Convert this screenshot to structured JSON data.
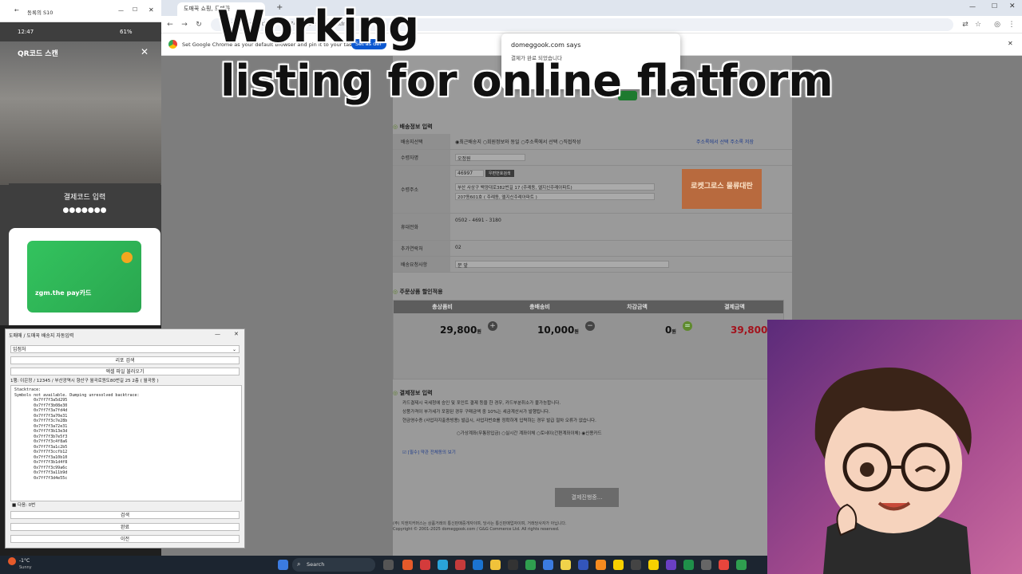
{
  "overlay": {
    "line1": "Working",
    "line2": "listing for online flatform"
  },
  "browser": {
    "tabs": [
      {
        "label": "도매꾹 쇼핑, 도매꾹",
        "active": true
      }
    ],
    "address": "…/?zreqPresentInfo=3267489&zreqPresentInfo",
    "infobar_text": "Set Google Chrome as your default browser and pin it to your taskbar",
    "infobar_button": "Set as def"
  },
  "alert": {
    "title": "domeggook.com says",
    "message": "결제가 완료 되었습니다"
  },
  "phone": {
    "title": "동록의 S10",
    "status_time": "12:47",
    "status_battery": "61%",
    "qr_title": "QR코드 스캔",
    "paycode_title": "결제코드 입력",
    "paycode_dots": "●●●●●●●",
    "card_label": "zgm.the pay카드"
  },
  "delivery": {
    "section_title": "배송정보 입력",
    "rows": [
      {
        "label": "배송지선택",
        "value": "◉최근배송지  ○회원정보와 동일  ○주소록에서 선택  ○직접작성"
      },
      {
        "label": "수령자명",
        "value": "오정원"
      },
      {
        "label": "수령주소",
        "value": "46997"
      },
      {
        "label": "휴대전화",
        "value": "0502 - 4691 - 3180"
      },
      {
        "label": "추가연락처",
        "value": "02"
      },
      {
        "label": "배송요청사항",
        "value": "문 앞"
      }
    ],
    "addr_line1": "부산 사상구 백양대로382번길 17 (주례동, 엘지신주례아파트)",
    "addr_line2": "207동601호 ( 주례동, 엘지신주례아파트 )",
    "zip_button": "우편번호검색",
    "right_links": "주소록에서 선택  주소록 저장",
    "banner_text": "로켓그로스 물류대란"
  },
  "summary": {
    "section_title": "주문상품 할인적용",
    "headers": [
      "총상품비",
      "총배송비",
      "차감금액",
      "결제금액"
    ],
    "product_total": "29,800",
    "shipping_total": "10,000",
    "deduction": "0",
    "payment_total": "39,800",
    "unit": "원"
  },
  "payment": {
    "section_title": "결제정보 입력",
    "notes": [
      "카드결제시 국세청에 승인 및 포인트 결제 등을 한 경우, 카드부분취소가 불가능합니다.",
      "상품가격이 부가세가 포함된 경우 구매금액 중 10%는 세금계산서가 발행됩니다.",
      "현금영수증 (사업자지출증빙용) 발급시, 사업자번호를 정확하게 입력하는 경우 발급 절차 오류가 없습니다."
    ],
    "methods": "○가상계좌(무통장입금)  ○실시간 계좌이체  ○토네이(간편계좌이체)  ◉신용카드",
    "agree_text": "[필수] 약관 전체동의 보기",
    "pay_button": "결제진행중..."
  },
  "footer": {
    "lines": [
      "(주) 지앤지커머스는 상품거래의 통신판매중개자이며, 당사는 통신판매업자이며, 거래당사자가 아닙니다.",
      "Copyright © 2001-2025 domeggook.com / G&G Commerce Ltd. All rights reserved."
    ]
  },
  "autowin": {
    "title": "도매매 / 도매꾹 배송지 자동입력",
    "dropdown": "입점처",
    "btn1": "리포 검색",
    "btn2": "엑셀 파일 불러오기",
    "status": "1행: 이은정 / 12345 / 부산광역시 향산구 월곡로원도80번길 25 2층 ( 월곡동 )",
    "log": "Stacktrace:\nSymbols not available. Dumping unresolved backtrace:\n        0x7ff7f3a5d295\n        0x7ff7f3b08e30\n        0x7ff7f3a7fd4d\n        0x7ff7f3a70e31\n        0x7ff7f3c7e28b\n        0x7ff7f3a72e31\n        0x7ff7f3b13e3d\n        0x7ff7f3b7e5f3\n        0x7ff7f3c4f8a6\n        0x7ff7f3a1c2b5\n        0x7ff7f3ccfb12\n        0x7ff7f3a10b10\n        0x7ff7f3b1d4f8\n        0x7ff7f3c99a6c\n        0x7ff7f3a11b9d\n        0x7ff7f3d4e55c",
    "row_status": "■ 다음: 0번",
    "b_next": "검색",
    "b_done": "완료",
    "b_prev": "이전"
  },
  "taskbar": {
    "weather": "-1°C",
    "weather_desc": "Sunny",
    "search": "Search"
  }
}
